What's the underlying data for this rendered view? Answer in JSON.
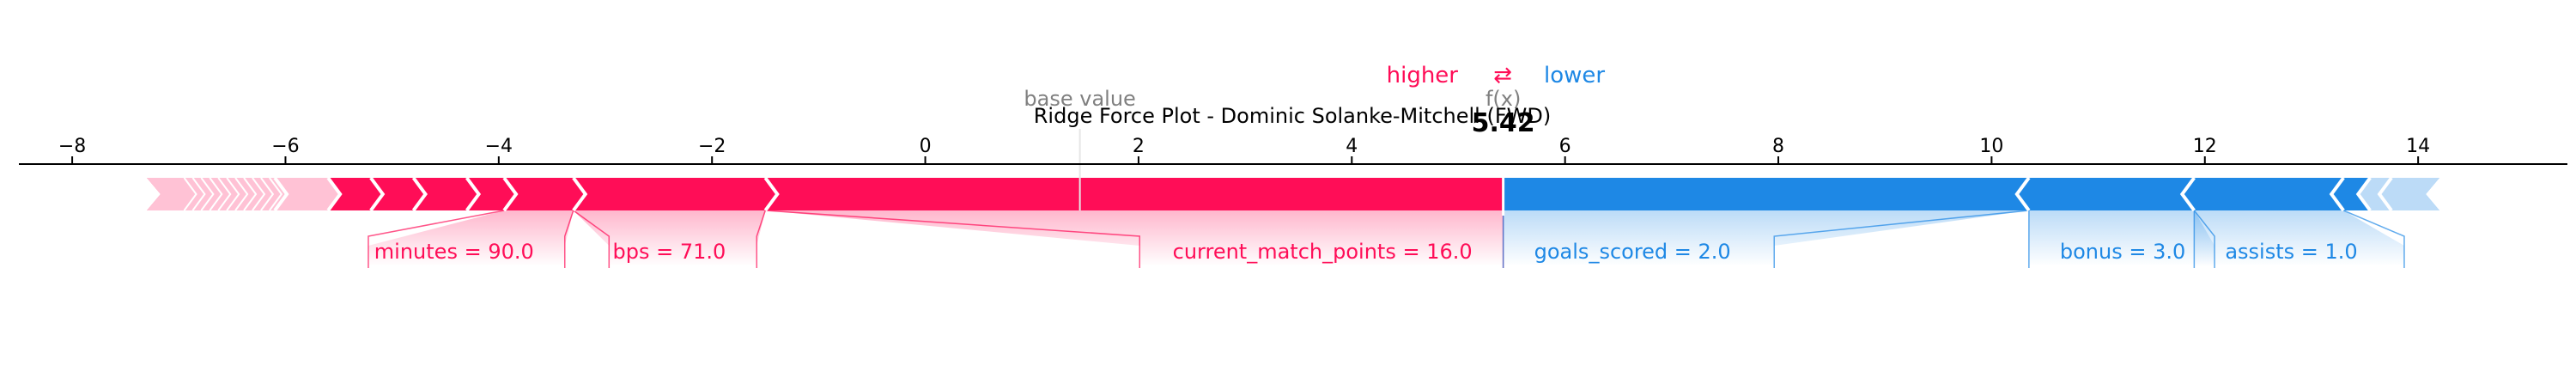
{
  "chart_data": {
    "type": "force_plot",
    "title": "Ridge Force Plot - Dominic Solanke-Mitchell (FWD)",
    "legend": {
      "higher": "higher",
      "arrow": "⇄",
      "lower": "lower"
    },
    "base_value_label": "base value",
    "output_label": "f(x)",
    "base_value": 1.45,
    "output_value": 5.42,
    "output_value_text": "5.42",
    "xlim": [
      -8.5,
      15.4
    ],
    "ticks": [
      -8,
      -6,
      -4,
      -2,
      0,
      2,
      4,
      6,
      8,
      10,
      12,
      14
    ],
    "tick_labels": [
      "−8",
      "−6",
      "−4",
      "−2",
      "0",
      "2",
      "4",
      "6",
      "8",
      "10",
      "12",
      "14"
    ],
    "positive_segments": [
      {
        "start": -7.3,
        "end": -6.1
      },
      {
        "start": -6.1,
        "end": -5.6
      },
      {
        "start": -5.6,
        "end": -5.2
      },
      {
        "start": -5.2,
        "end": -4.8
      },
      {
        "start": -4.8,
        "end": -4.3
      },
      {
        "start": -4.3,
        "end": -3.95
      },
      {
        "start": -3.95,
        "end": -3.3
      },
      {
        "start": -3.3,
        "end": -1.5
      },
      {
        "start": -1.5,
        "end": 5.42
      }
    ],
    "negative_segments": [
      {
        "start": 5.42,
        "end": 10.35
      },
      {
        "start": 10.35,
        "end": 11.9
      },
      {
        "start": 11.9,
        "end": 13.3
      },
      {
        "start": 13.3,
        "end": 13.55
      },
      {
        "start": 13.55,
        "end": 13.75
      },
      {
        "start": 13.75,
        "end": 14.2
      }
    ],
    "labels": [
      {
        "text": "minutes = 90.0",
        "sign": "positive",
        "value_start": -3.95,
        "value_end": -3.3
      },
      {
        "text": "bps = 71.0",
        "sign": "positive",
        "value_start": -3.3,
        "value_end": -1.5
      },
      {
        "text": "current_match_points = 16.0",
        "sign": "positive",
        "value_start": -1.5,
        "value_end": 5.42
      },
      {
        "text": "goals_scored = 2.0",
        "sign": "negative",
        "value_start": 5.42,
        "value_end": 10.35
      },
      {
        "text": "bonus = 3.0",
        "sign": "negative",
        "value_start": 10.35,
        "value_end": 11.9
      },
      {
        "text": "assists = 1.0",
        "sign": "negative",
        "value_start": 11.9,
        "value_end": 13.3
      }
    ],
    "colors": {
      "positive": "#ff0d57",
      "negative": "#1e88e5",
      "axis": "#000000",
      "base_value": "#808080"
    }
  }
}
